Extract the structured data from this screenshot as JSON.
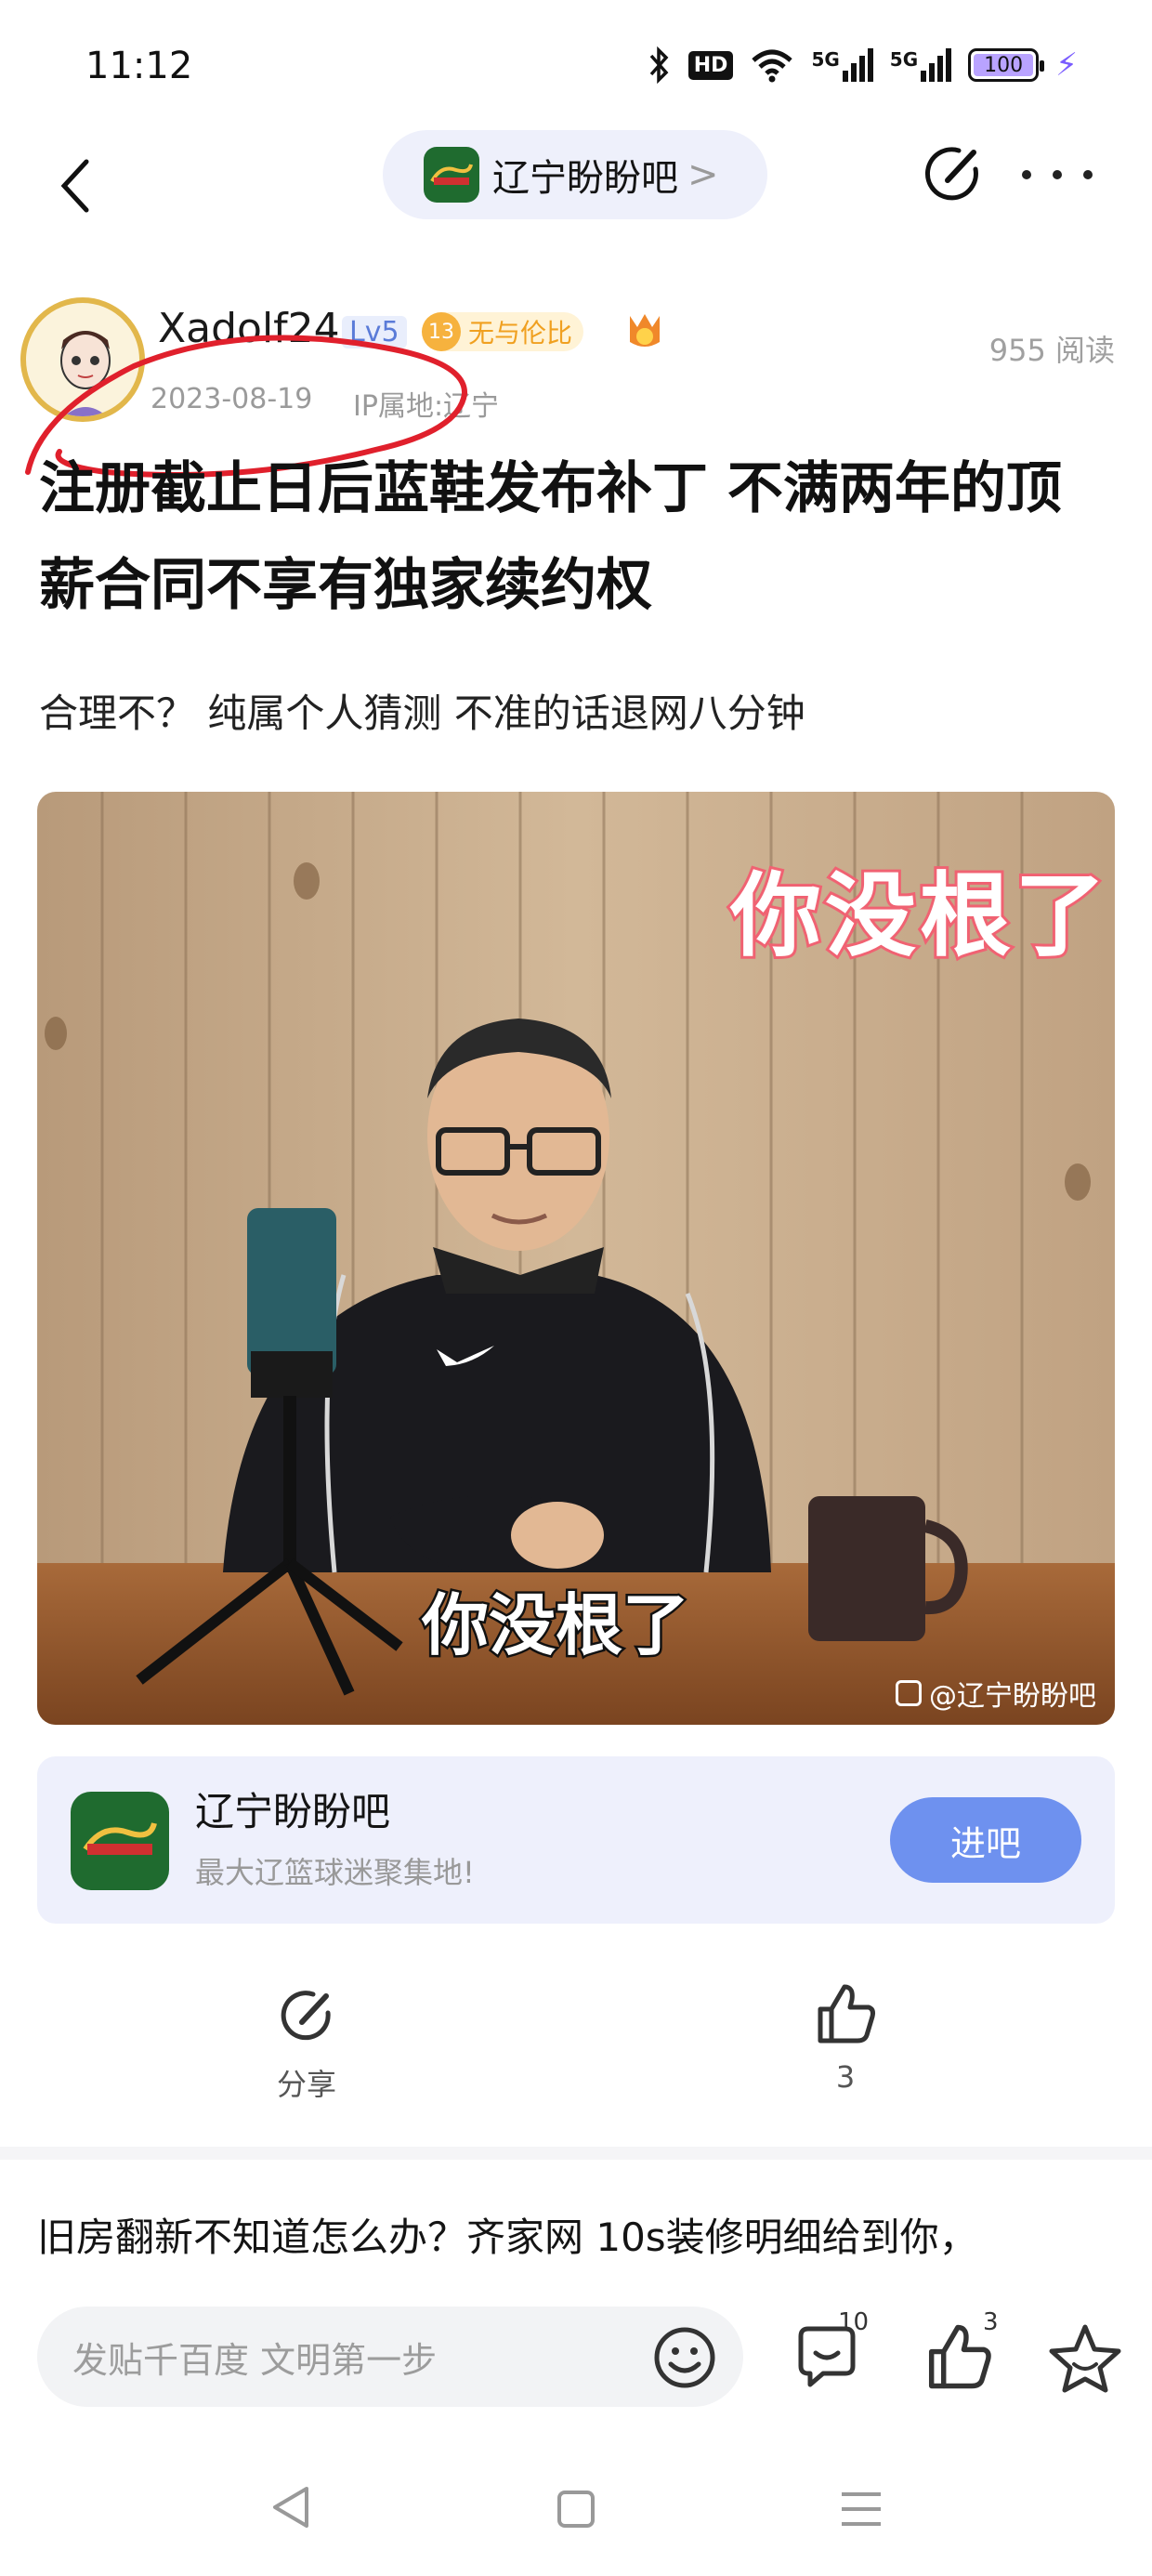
{
  "status_bar": {
    "time": "11:12",
    "battery": "100",
    "network_1": "5G",
    "network_2": "5G",
    "hd_label": "HD"
  },
  "nav": {
    "forum_name": "辽宁盼盼吧",
    "chevron": ">"
  },
  "author": {
    "name": "Xadolf24",
    "level": "Lv5",
    "fan_level": "13",
    "fan_title": "无与伦比",
    "date": "2023-08-19",
    "ip": "IP属地:辽宁",
    "read_count": "955 阅读"
  },
  "post": {
    "title": "注册截止日后蓝鞋发布补丁 不满两年的顶薪合同不享有独家续约权",
    "body": "合理不？ 纯属个人猜测 不准的话退网八分钟",
    "image": {
      "caption_top": "你没根了",
      "caption_bottom": "你没根了",
      "watermark": "@辽宁盼盼吧"
    }
  },
  "forum_card": {
    "name": "辽宁盼盼吧",
    "description": "最大辽篮球迷聚集地!",
    "join_label": "进吧"
  },
  "actions": {
    "share_label": "分享",
    "like_count": "3"
  },
  "ad": {
    "text": "旧房翻新不知道怎么办？齐家网 10s装修明细给到你，"
  },
  "input_bar": {
    "placeholder": "发贴千百度 文明第一步",
    "comment_count": "10",
    "like_count": "3"
  },
  "colors": {
    "accent_blue": "#6e91ef",
    "card_bg": "#eef0fc",
    "annotation_red": "#e0202c",
    "forum_green": "#1f6b2f"
  }
}
